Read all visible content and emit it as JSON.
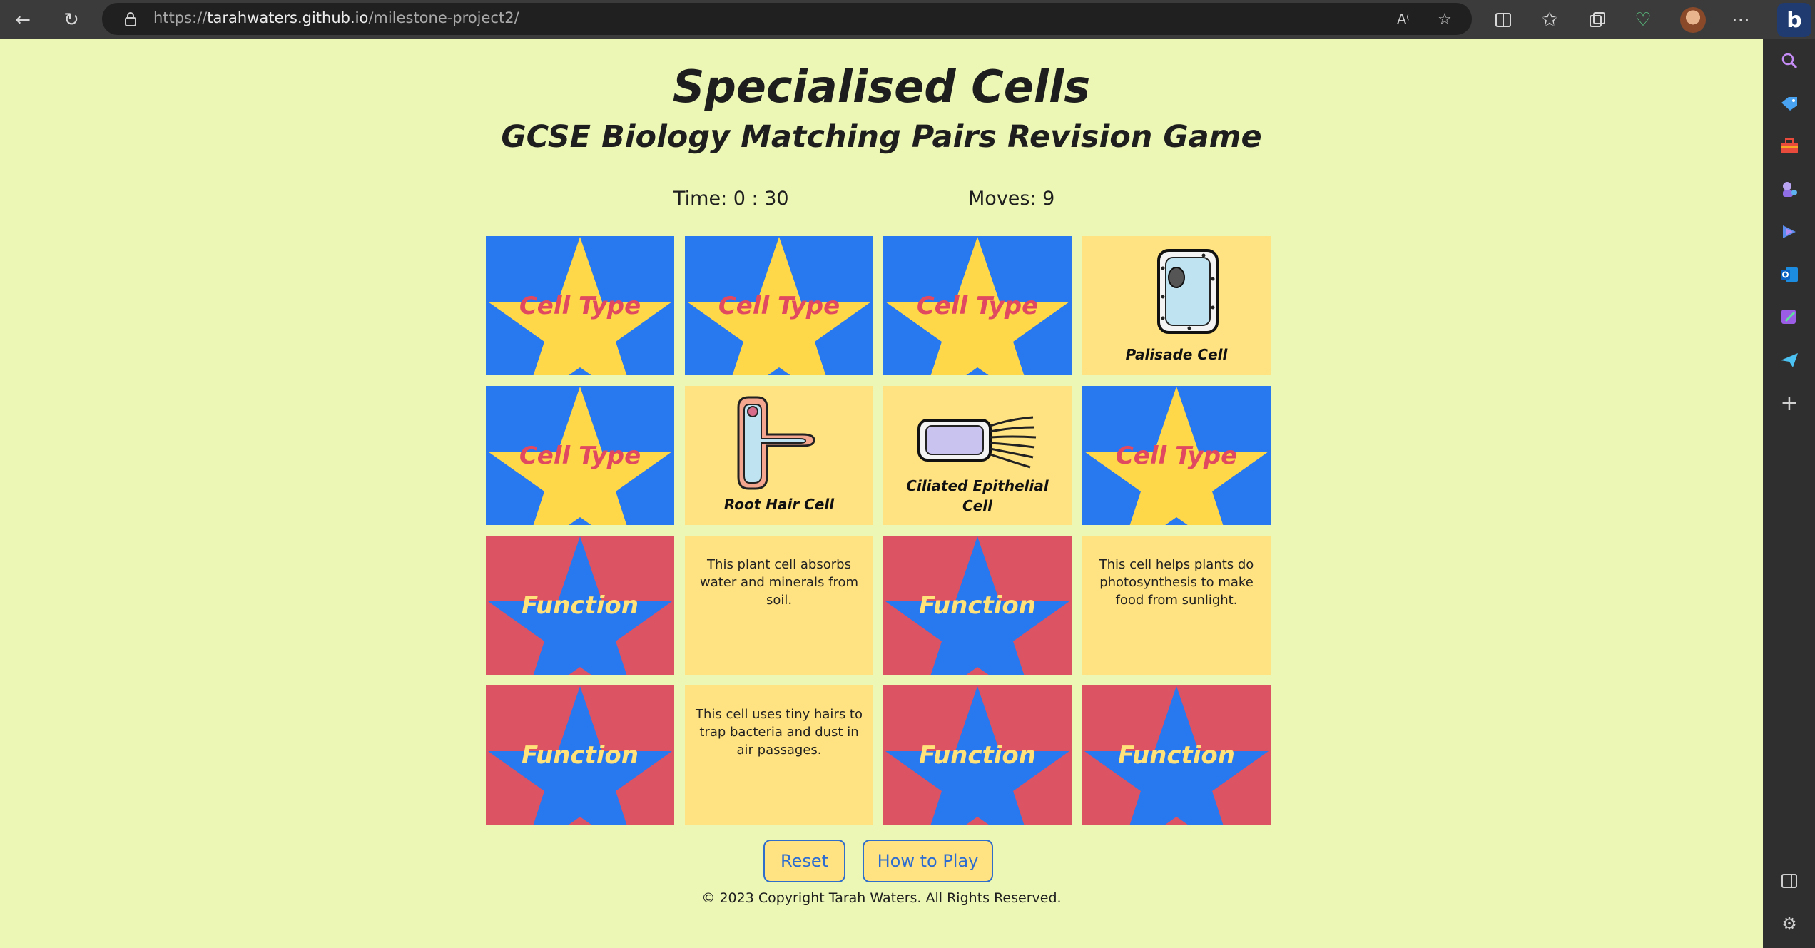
{
  "browser": {
    "url_prefix": "https://",
    "url_host": "tarahwaters.github.io",
    "url_path": "/milestone-project2/",
    "icons": {
      "back": "back-arrow-icon",
      "refresh": "refresh-icon",
      "lock": "lock-icon",
      "read_aloud": "read-aloud-icon",
      "favorite": "star-outline-icon",
      "split": "split-screen-icon",
      "favorites": "favorites-icon",
      "collections": "collections-icon",
      "health": "heart-pulse-icon",
      "profile": "profile-avatar",
      "more": "more-icon",
      "bing": "bing-icon"
    }
  },
  "sidebar": {
    "items": [
      "search-icon",
      "tag-icon",
      "briefcase-icon",
      "games-icon",
      "copilot-icon",
      "outlook-icon",
      "designer-icon",
      "send-icon",
      "add-icon",
      "panel-icon",
      "settings-icon"
    ]
  },
  "page": {
    "title": "Specialised Cells",
    "subtitle": "GCSE Biology Matching Pairs Revision Game",
    "timer": "Time: 0 : 30",
    "moves": "Moves: 9",
    "cards": [
      {
        "kind": "back",
        "label": "Cell Type",
        "bg": "#2878f0",
        "star": "#ffd84a",
        "text": "#e0495f"
      },
      {
        "kind": "back",
        "label": "Cell Type",
        "bg": "#2878f0",
        "star": "#ffd84a",
        "text": "#e0495f"
      },
      {
        "kind": "back",
        "label": "Cell Type",
        "bg": "#2878f0",
        "star": "#ffd84a",
        "text": "#e0495f"
      },
      {
        "kind": "cell",
        "image": "palisade-cell-image",
        "name": "Palisade Cell"
      },
      {
        "kind": "back",
        "label": "Cell Type",
        "bg": "#2878f0",
        "star": "#ffd84a",
        "text": "#e0495f"
      },
      {
        "kind": "cell",
        "image": "root-hair-cell-image",
        "name": "Root Hair Cell"
      },
      {
        "kind": "cell",
        "image": "ciliated-cell-image",
        "name": "Ciliated Epithelial Cell"
      },
      {
        "kind": "back",
        "label": "Cell Type",
        "bg": "#2878f0",
        "star": "#ffd84a",
        "text": "#e0495f"
      },
      {
        "kind": "back",
        "label": "Function",
        "bg": "#dc5363",
        "star": "#2878f0",
        "text": "#ffe27a"
      },
      {
        "kind": "text",
        "text": "This plant cell absorbs water and minerals from soil."
      },
      {
        "kind": "back",
        "label": "Function",
        "bg": "#dc5363",
        "star": "#2878f0",
        "text": "#ffe27a"
      },
      {
        "kind": "text",
        "text": "This cell helps plants do photosynthesis to make food from sunlight."
      },
      {
        "kind": "back",
        "label": "Function",
        "bg": "#dc5363",
        "star": "#2878f0",
        "text": "#ffe27a"
      },
      {
        "kind": "text",
        "text": "This cell uses tiny hairs to trap bacteria and dust in air passages."
      },
      {
        "kind": "back",
        "label": "Function",
        "bg": "#dc5363",
        "star": "#2878f0",
        "text": "#ffe27a"
      },
      {
        "kind": "back",
        "label": "Function",
        "bg": "#dc5363",
        "star": "#2878f0",
        "text": "#ffe27a"
      }
    ],
    "buttons": {
      "reset": "Reset",
      "how_to_play": "How to Play"
    },
    "footer": "© 2023 Copyright Tarah Waters. All Rights Reserved.",
    "colors": {
      "page_bg": "#ecf7b5",
      "card_face": "#ffe282",
      "button_text": "#2c6cd0"
    }
  }
}
